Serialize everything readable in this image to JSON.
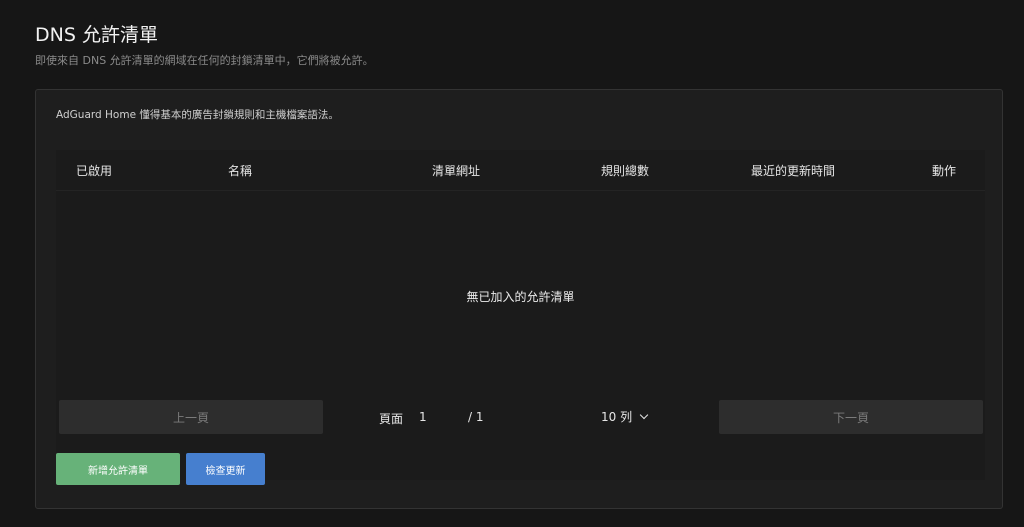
{
  "header": {
    "title": "DNS 允許清單",
    "subtitle": "即使來自 DNS 允許清單的網域在任何的封鎖清單中，它們將被允許。"
  },
  "card": {
    "description": "AdGuard Home 懂得基本的廣告封鎖規則和主機檔案語法。"
  },
  "table": {
    "columns": [
      "已啟用",
      "名稱",
      "清單網址",
      "規則總數",
      "最近的更新時間",
      "動作"
    ],
    "empty_text": "無已加入的允許清單"
  },
  "pagination": {
    "prev_label": "上一頁",
    "next_label": "下一頁",
    "page_label": "頁面",
    "current_page": "1",
    "total_pages": "/ 1",
    "rows_per_page": "10 列"
  },
  "actions": {
    "add_label": "新增允許清單",
    "check_label": "檢查更新"
  },
  "colors": {
    "add_button": "#67b279",
    "check_button": "#467fcf",
    "background": "#161616",
    "card": "#1e1e1e"
  }
}
